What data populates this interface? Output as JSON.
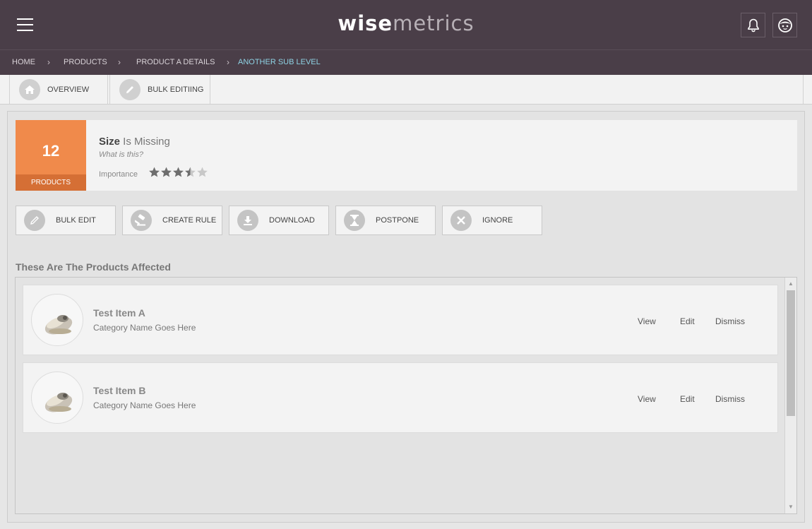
{
  "header": {
    "logo_part1": "wise",
    "logo_part2": "metrics",
    "menu_icon": "hamburger-icon",
    "notification_icon": "bell-icon",
    "profile_icon": "user-face-icon"
  },
  "breadcrumb": {
    "items": [
      "HOME",
      "PRODUCTS",
      "PRODUCT A DETAILS",
      "ANOTHER SUB LEVEL"
    ],
    "separator": "›"
  },
  "tabs": [
    {
      "label": "OVERVIEW",
      "icon": "home-icon"
    },
    {
      "label": "BULK EDITIING",
      "icon": "pencil-icon"
    }
  ],
  "issue": {
    "count": "12",
    "count_label": "PRODUCTS",
    "title_bold": "Size",
    "title_rest": " Is Missing",
    "help": "What is this?",
    "importance_label": "Importance",
    "importance_rating": 3.5,
    "importance_max": 5
  },
  "actions": [
    {
      "label": "BULK EDIT",
      "icon": "pencil-icon"
    },
    {
      "label": "CREATE RULE",
      "icon": "gavel-icon"
    },
    {
      "label": "DOWNLOAD",
      "icon": "download-icon"
    },
    {
      "label": "POSTPONE",
      "icon": "hourglass-icon"
    },
    {
      "label": "IGNORE",
      "icon": "close-icon"
    }
  ],
  "section_title": "These Are The Products Affected",
  "products": [
    {
      "name": "Test Item A",
      "category": "Category Name Goes Here",
      "view": "View",
      "edit": "Edit",
      "dismiss": "Dismiss"
    },
    {
      "name": "Test Item B",
      "category": "Category Name Goes Here",
      "view": "View",
      "edit": "Edit",
      "dismiss": "Dismiss"
    }
  ],
  "colors": {
    "header_bg": "#4a3e48",
    "accent_orange": "#f08a4b",
    "breadcrumb_active": "#8ed2e4"
  }
}
